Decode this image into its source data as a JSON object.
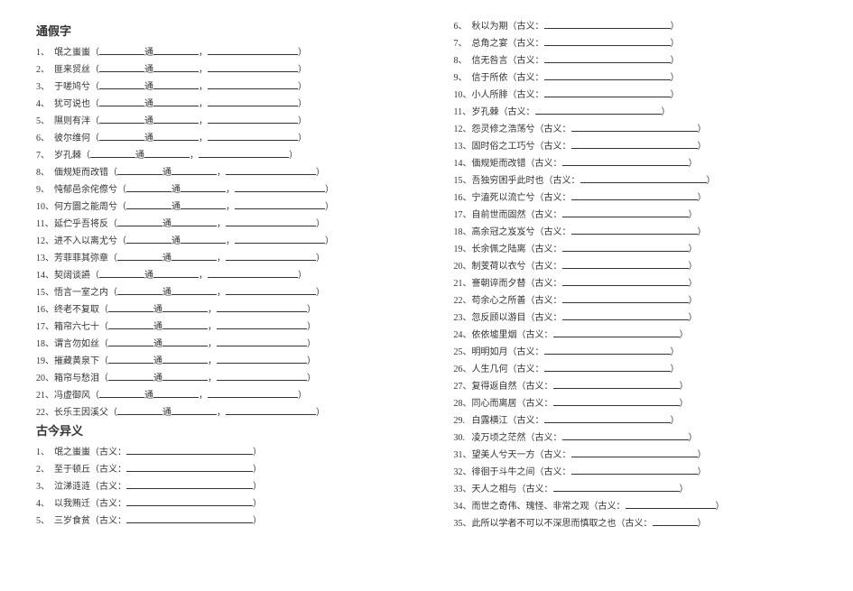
{
  "sections": {
    "s1_title": "通假字",
    "s2_title": "古今异义"
  },
  "tongjia": [
    "氓之蚩蚩",
    "匪来贸丝",
    "于嗟鸠兮",
    "犹可说也",
    "隰则有泮",
    "彼尔维何",
    "    岁孔棘",
    "偭规矩而改错",
    "忳郁邑余侘傺兮",
    "何方圜之能周兮",
    "延伫乎吾将反",
    "进不入以离尤兮",
    "芳菲菲其弥章",
    "契阔谈讌",
    "悟言一室之内",
    "终老不复取",
    "箱帘六七十",
    "谓言勿如丝",
    "摧藏黄泉下",
    "箱帘与愁泪",
    "冯虚御风",
    "长乐王因溪父"
  ],
  "gujin_left": [
    "氓之蚩蚩",
    "至于顿丘",
    "泣涕涟涟",
    "以我贿迁",
    "三岁食贫"
  ],
  "gujin_right": [
    "秋以为期",
    "总角之宴",
    "信无咎言",
    "信于所依",
    "小人所腓",
    "    岁孔棘",
    "怨灵修之浩荡兮",
    "固时俗之工巧兮",
    "偭规矩而改错",
    "吾独穷困乎此时也",
    "宁溘死以流亡兮",
    "自前世而固然",
    "高余冠之岌岌兮",
    "长余佩之陆离",
    "制芰荷以衣兮",
    "謇朝谇而夕替",
    "苟余心之所善",
    "忽反顾以游目",
    "依依墟里烟",
    "明明如月",
    "人生几何",
    "复得返自然",
    "同心而离居",
    "白露横江",
    "凌万顷之茫然",
    "望美人兮天一方",
    "徘徊于斗牛之间",
    "天人之相与",
    "而世之奇伟、瑰怪、非常之观",
    "此所以学者不可以不深思而慎取之也"
  ],
  "labels": {
    "tong": "通",
    "guyi": "古义：",
    "comma": "，",
    "lp": "（",
    "rp": "）"
  }
}
